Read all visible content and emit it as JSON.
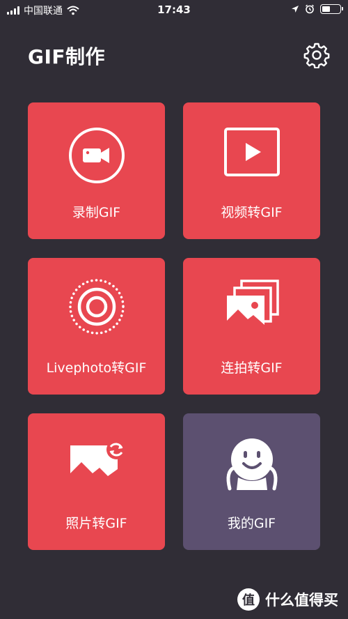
{
  "status_bar": {
    "carrier": "中国联通",
    "time": "17:43"
  },
  "header": {
    "title": "GIF制作",
    "settings_icon": "gear-icon"
  },
  "tiles": [
    {
      "label": "录制GIF",
      "icon": "video-camera-icon",
      "color": "#e84750"
    },
    {
      "label": "视频转GIF",
      "icon": "play-video-icon",
      "color": "#e84750"
    },
    {
      "label": "Livephoto转GIF",
      "icon": "live-photo-icon",
      "color": "#e84750"
    },
    {
      "label": "连拍转GIF",
      "icon": "burst-photos-icon",
      "color": "#e84750"
    },
    {
      "label": "照片转GIF",
      "icon": "photo-convert-icon",
      "color": "#e84750"
    },
    {
      "label": "我的GIF",
      "icon": "smiling-character-icon",
      "color": "#5c5070"
    }
  ],
  "watermark": {
    "badge": "值",
    "text": "什么值得买"
  }
}
